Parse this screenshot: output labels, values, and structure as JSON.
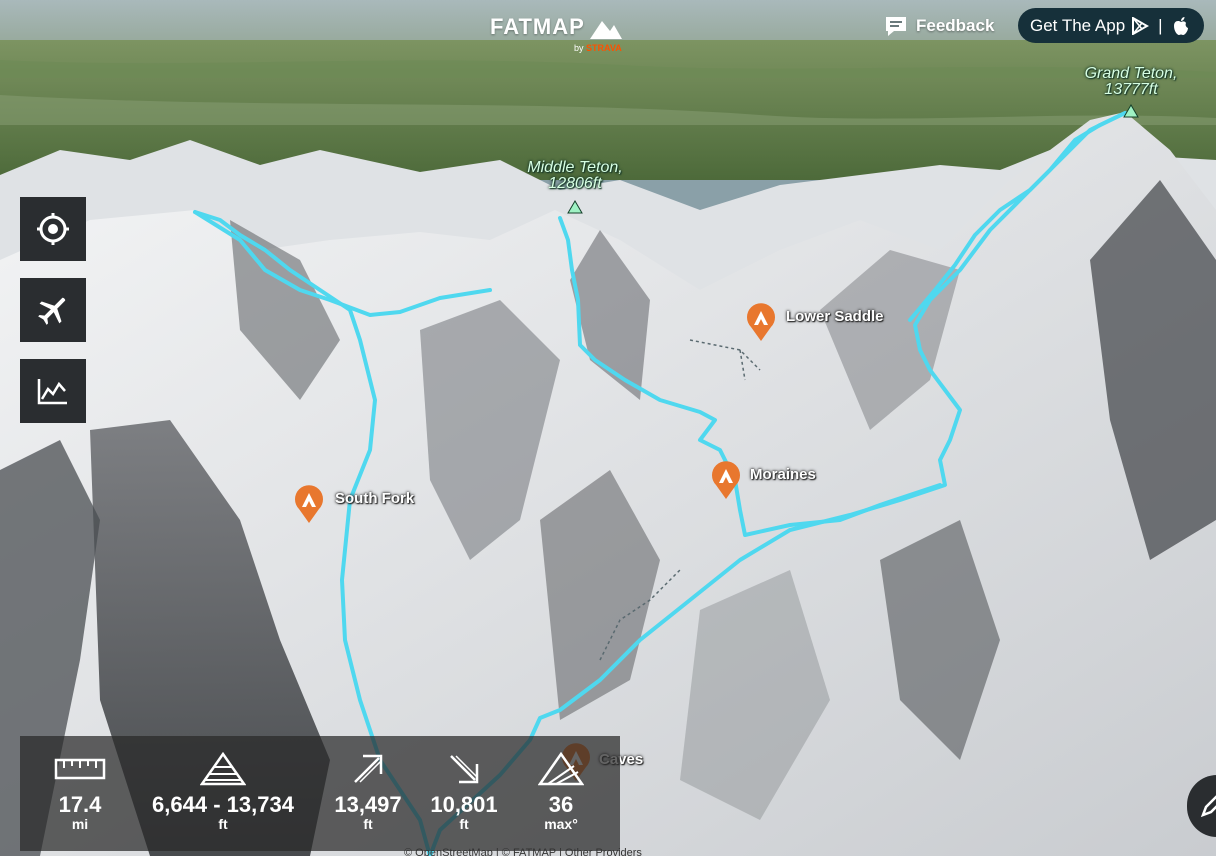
{
  "brand": {
    "logo": "FATMAP",
    "byline_prefix": "by",
    "byline_brand": "STRAVA"
  },
  "header": {
    "feedback_label": "Feedback",
    "feedback_icon": "chat-bubble-icon",
    "get_app_label": "Get The App",
    "get_app_separator": "|",
    "store_icons": [
      "google-play-icon",
      "apple-icon"
    ]
  },
  "toolbar": {
    "buttons": [
      {
        "name": "locate",
        "icon": "crosshair-icon"
      },
      {
        "name": "fly",
        "icon": "airplane-icon"
      },
      {
        "name": "profile",
        "icon": "elevation-chart-icon"
      }
    ]
  },
  "peaks": [
    {
      "name": "Grand Teton,",
      "elevation": "13777ft"
    },
    {
      "name": "Middle Teton,",
      "elevation": "12806ft"
    }
  ],
  "pois": [
    {
      "name": "Lower Saddle",
      "icon": "camp-icon"
    },
    {
      "name": "Moraines",
      "icon": "camp-icon"
    },
    {
      "name": "South Fork",
      "icon": "camp-icon"
    },
    {
      "name": "Caves",
      "icon": "camp-icon"
    }
  ],
  "stats": [
    {
      "icon": "ruler-icon",
      "value": "17.4",
      "unit": "mi"
    },
    {
      "icon": "elevation-range-icon",
      "value": "6,644 - 13,734",
      "unit": "ft"
    },
    {
      "icon": "ascent-arrow-icon",
      "value": "13,497",
      "unit": "ft"
    },
    {
      "icon": "descent-arrow-icon",
      "value": "10,801",
      "unit": "ft"
    },
    {
      "icon": "slope-angle-icon",
      "value": "36",
      "unit": "max°"
    }
  ],
  "attribution": "© OpenStreetMap | © FATMAP | Other Providers",
  "colors": {
    "route": "#4fd8ef",
    "poi": "#e8772e",
    "toolbar": "#2a2d30",
    "app_button": "#16303a",
    "strava": "#fc5200"
  }
}
